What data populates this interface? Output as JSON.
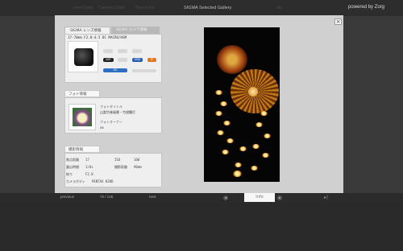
{
  "topbar": {
    "nav": [
      "Lens Guide",
      "Camera Guide",
      "How to Ad",
      "Ab..."
    ],
    "gallery_title": "SIGMA Selected Gallery",
    "powered_by": "powered by Zorg"
  },
  "modal": {
    "close_label": "×",
    "tabs": [
      {
        "label": "SIGMA レンズ情報",
        "active": true
      },
      {
        "label": "SIGMA カメラ情報",
        "active": false
      }
    ],
    "lens": {
      "name": "17-70mm F2.8-4.5 DC MACRO/HSM",
      "badges": [
        "ASP",
        "HSM",
        "IF",
        "DG"
      ]
    },
    "photo_info": {
      "header": "フォト情報",
      "title_label": "フォトタイトル",
      "title_value": "山梨竹林風景・竹燈籠灯",
      "owner_label": "フォトオーナー",
      "owner_value": "xx"
    },
    "exif": {
      "header": "撮影情報",
      "rows": [
        {
          "label": "焦点距離",
          "value": "17",
          "label2": "ISO",
          "value2": "100"
        },
        {
          "label": "露出時間",
          "value": "1/6s",
          "label2": "撮影距離",
          "value2": "90mm"
        },
        {
          "label": "絞り",
          "value": "F2.8",
          "label2": "",
          "value2": ""
        },
        {
          "label": "カメラボディ",
          "value": "PENTAX K20D",
          "label2": "",
          "value2": ""
        }
      ]
    }
  },
  "bottombar": {
    "previous": "previous",
    "counter": "76 / 145",
    "next": "next",
    "info_tab": "Info",
    "prev_arrow": "◂",
    "next_arrow": "▸",
    "play_icon": "▸|"
  },
  "colors": {
    "background": "#2a2a2a",
    "modal": "#d0d0d0",
    "asp_badge": "#222222",
    "hsm_badge": "#2a5db0",
    "if_badge": "#e07820",
    "dg_badge": "#2f6fc0"
  }
}
